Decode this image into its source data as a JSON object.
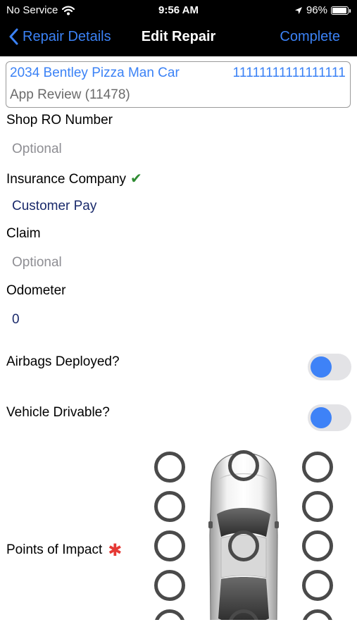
{
  "status_bar": {
    "carrier": "No Service",
    "time": "9:56 AM",
    "battery_text": "96%",
    "battery_level": 0.96
  },
  "nav": {
    "back_label": "Repair Details",
    "title": "Edit Repair",
    "complete_label": "Complete"
  },
  "vehicle": {
    "name": "2034 Bentley Pizza Man Car",
    "vin": "11111111111111111",
    "subtitle": "App Review (11478)"
  },
  "fields": {
    "shop_ro": {
      "label": "Shop RO Number",
      "placeholder": "Optional",
      "value": ""
    },
    "insurance": {
      "label": "Insurance Company",
      "value": "Customer Pay",
      "verified": true
    },
    "claim": {
      "label": "Claim",
      "placeholder": "Optional",
      "value": ""
    },
    "odometer": {
      "label": "Odometer",
      "value": "0"
    }
  },
  "toggles": {
    "airbags": {
      "label": "Airbags Deployed?",
      "on": false
    },
    "drivable": {
      "label": "Vehicle Drivable?",
      "on": false
    }
  },
  "impact": {
    "label": "Points of Impact",
    "required": true
  },
  "colors": {
    "accent": "#3b82f6",
    "header_bg": "#000000",
    "value_text": "#1a2a6b",
    "placeholder": "#8e8e93",
    "check": "#2e8b32",
    "required": "#e53935",
    "toggle_knob": "#3e82f7"
  },
  "icons": {
    "back": "chevron-left-icon",
    "wifi": "wifi-icon",
    "location": "location-arrow-icon",
    "battery": "battery-icon",
    "verified": "checkmark-icon",
    "required": "asterisk-icon",
    "car": "car-top-view-icon"
  }
}
